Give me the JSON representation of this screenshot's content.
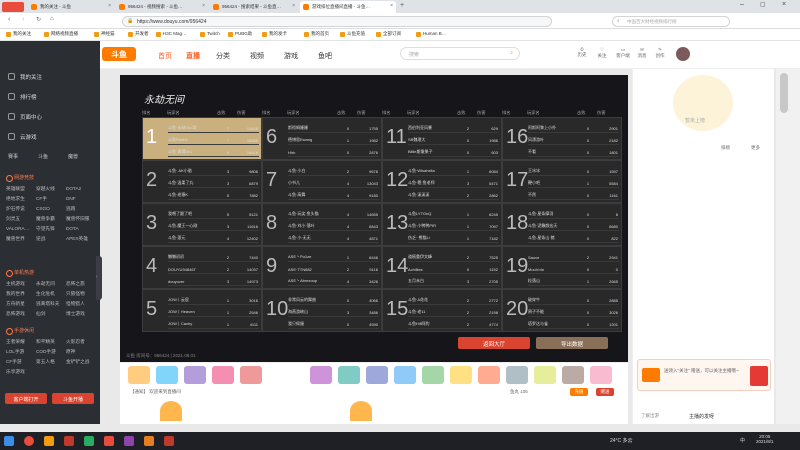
{
  "browser": {
    "tabs": [
      {
        "label": "我的关注 - 斗鱼",
        "active": false
      },
      {
        "label": "956424 - 视频搜索 - 斗鱼…",
        "active": false
      },
      {
        "label": "956424 - 搜索结果 - 斗鱼直…",
        "active": false
      },
      {
        "label": "游戏排位直播间直播 - 斗鱼…",
        "active": true
      }
    ],
    "url": "https://www.douyu.com/956424",
    "search_placeholder": "中国百大财经视频排行榜",
    "bookmarks": [
      "我的关注",
      "网络视频直播",
      "神经猫",
      "开发者",
      "H3C Mag…",
      "Twitch",
      "PUBG助",
      "我的发卡",
      "我的首页",
      "斗鱼充值",
      "全部订阅",
      "Human B…"
    ]
  },
  "header": {
    "logo": "斗鱼",
    "nav": [
      "首页",
      "直播",
      "分类",
      "视频",
      "游戏",
      "鱼吧"
    ],
    "search_placeholder": "搜索",
    "icons": [
      "历史",
      "关注",
      "客户端",
      "消息",
      "创作"
    ]
  },
  "sidebar": {
    "top": [
      {
        "label": "我的关注",
        "icon": "heart-icon"
      },
      {
        "label": "排行榜",
        "icon": "trophy-icon"
      },
      {
        "label": "页面中心",
        "icon": "grid-icon"
      },
      {
        "label": "云游戏",
        "icon": "cloud-icon"
      }
    ],
    "row_icons": [
      "赛事",
      "斗鱼",
      "魔兽"
    ],
    "sections": [
      {
        "title": "网游竞技",
        "items": [
          "英雄联盟",
          "穿越火线",
          "DOTA2",
          "绝地求生",
          "CF手",
          "DNF",
          "炉石传说",
          "CSGO",
          "逃跑",
          "剑灵五",
          "魔兽争霸",
          "魔兽怀旧服",
          "VALORA…",
          "守望先锋",
          "DOTA",
          "魔兽世界",
          "逆战",
          "APEX英雄"
        ]
      },
      {
        "title": "单机热游",
        "items": [
          "主机游戏",
          "永劫无间",
          "恐怖之旅",
          "我的世界",
          "生化危机",
          "只狼怪物",
          "方舟新星",
          "逃离塔科夫",
          "怪物猎人",
          "恐怖游戏",
          "仙剑",
          "博士游戏"
        ]
      },
      {
        "title": "手游休闲",
        "items": [
          "王者荣耀",
          "和平精英",
          "火影忍者",
          "LOL手游",
          "COD手游",
          "原神",
          "CF手游",
          "第五人格",
          "金铲铲之战",
          "乐享游戏"
        ]
      }
    ],
    "buttons": [
      "客户端打开",
      "斗鱼开播"
    ]
  },
  "player": {
    "calligraphy": "永劫无间",
    "columns": [
      "排名",
      "玩家名",
      "击败",
      "伤害"
    ],
    "groups": [
      {
        "rank": "1",
        "players": [
          [
            "斗鱼·永劫Gk4哥",
            "7",
            "14408"
          ],
          [
            "斗鱼Rebbit",
            "7",
            "15586"
          ],
          [
            "斗鱼·素得Ex1",
            "4",
            "16618"
          ]
        ]
      },
      {
        "rank": "2",
        "players": [
          [
            "斗鱼·.AK小骆",
            "3",
            "9806"
          ],
          [
            "斗鱼·温柔了丸",
            "3",
            "6879"
          ],
          [
            "斗鱼·老猿K",
            "5",
            "7882"
          ]
        ]
      },
      {
        "rank": "3",
        "players": [
          [
            "我喂了跟了吧",
            "5",
            "5121"
          ],
          [
            "斗鱼-魔王一心刚",
            "3",
            "11616"
          ],
          [
            "斗鱼·菠元",
            "4",
            "12402"
          ]
        ]
      },
      {
        "rank": "4",
        "players": [
          [
            "懒懒初初",
            "2",
            "7440"
          ],
          [
            "DOUYU94846T",
            "2",
            "14037"
          ],
          [
            "douyuver",
            "3",
            "14973"
          ]
        ]
      },
      {
        "rank": "5",
        "players": [
          [
            "JOW丨云屁",
            "1",
            "3016"
          ],
          [
            "JOW丨Heaven",
            "1",
            "2546"
          ],
          [
            "JOW丨Cachy",
            "1",
            "4111"
          ]
        ]
      },
      {
        "rank": "6",
        "players": [
          [
            "斯彻姆姗姗",
            "0",
            "1755"
          ],
          [
            "德博思Ewang",
            "1",
            "1982"
          ],
          [
            "Hhh",
            "0",
            "2876"
          ]
        ]
      },
      {
        "rank": "7",
        "players": [
          [
            "斗鱼·小白",
            "2",
            "9678"
          ],
          [
            "小书儿",
            "4",
            "13043"
          ],
          [
            "斗鱼·高舞",
            "4",
            "9180"
          ]
        ]
      },
      {
        "rank": "8",
        "players": [
          [
            "斗鱼·玩笑·鱼头猫",
            "4",
            "14655"
          ],
          [
            "斗鱼·刘小·落叶",
            "4",
            "6843"
          ],
          [
            "斗鱼·小·无无",
            "4",
            "4871"
          ]
        ]
      },
      {
        "rank": "9",
        "players": [
          [
            "ASE丶Pu1ze",
            "1",
            "6446"
          ],
          [
            "ASE·TTN682",
            "2",
            "5116"
          ],
          [
            "ASE丶Abrezoup",
            "4",
            "3426"
          ]
        ]
      },
      {
        "rank": "10",
        "players": [
          [
            "非常风云的舞曲",
            "0",
            "4066"
          ],
          [
            "海燕游峡山",
            "3",
            "3486"
          ],
          [
            "我只佩服",
            "0",
            "4590"
          ]
        ]
      },
      {
        "rank": "11",
        "players": [
          [
            "西伯利亚风暴",
            "2",
            "629"
          ],
          [
            "SB魏理大",
            "0",
            "1986"
          ],
          [
            "Billie斯嫩果子",
            "0",
            "603"
          ]
        ]
      },
      {
        "rank": "12",
        "players": [
          [
            "斗鱼·Wlsaheila",
            "1",
            "6084"
          ],
          [
            "斗鱼·羲·鱼老师",
            "3",
            "5471"
          ],
          [
            "斗鱼·溪溪溪",
            "2",
            "2862"
          ]
        ]
      },
      {
        "rank": "13",
        "players": [
          [
            "斗鱼LYTOnQ",
            "1",
            "6245"
          ],
          [
            "斗鱼·小鸭鸭PIR",
            "1",
            "7097"
          ],
          [
            "伤乏··熊猫Li",
            "1",
            "7182"
          ]
        ]
      },
      {
        "rank": "14",
        "players": [
          [
            "道痕重伊文峰",
            "2",
            "7525"
          ],
          [
            "Achillies",
            "0",
            "1152"
          ],
          [
            "五月未白",
            "3",
            "2705"
          ]
        ]
      },
      {
        "rank": "15",
        "players": [
          [
            "斗鱼·A花花",
            "2",
            "2772"
          ],
          [
            "斗鱼·老11",
            "2",
            "2198"
          ],
          [
            "斗鱼Hill阿豹",
            "2",
            "4774"
          ]
        ]
      },
      {
        "rank": "16",
        "players": [
          [
            "阿斯阿黎上小扑",
            "0",
            "2901"
          ],
          [
            "风漂游叶",
            "0",
            "2182"
          ],
          [
            "不看",
            "0",
            "1801"
          ]
        ]
      },
      {
        "rank": "17",
        "players": [
          [
            "王冰冰",
            "0",
            "1597"
          ],
          [
            "鞭小吧",
            "1",
            "5584"
          ],
          [
            "不然",
            "0",
            "1161"
          ]
        ]
      },
      {
        "rank": "18",
        "players": [
          [
            "斗鱼·星条摩羽",
            "0",
            "8"
          ],
          [
            "斗鱼·泥鳅颜宏天",
            "0",
            "6680"
          ],
          [
            "斗鱼-星条山·猪",
            "0",
            "822"
          ]
        ]
      },
      {
        "rank": "19",
        "players": [
          [
            "Sauve",
            "2",
            "2941"
          ],
          [
            "MouVnIn",
            "0",
            "0"
          ],
          [
            "粒落山",
            "1",
            "2665"
          ]
        ]
      },
      {
        "rank": "20",
        "players": [
          [
            "破穿牛",
            "0",
            "2885"
          ],
          [
            "鸦子不能",
            "0",
            "3026"
          ],
          [
            "塔罗达与雀",
            "0",
            "1201"
          ]
        ]
      }
    ],
    "btn_back": "返回大厅",
    "btn_export": "导出数据",
    "room_info": "斗鱼 房间号：956424 | 2021.08.01"
  },
  "gifts": {
    "labels": [
      "赠送大厅",
      "鲨鱼",
      "PK玩法",
      "赠送",
      "专属",
      "活动",
      "小铃铛",
      "鱼丸",
      "大星",
      "福袋",
      "宝箱"
    ],
    "status_left": "【通知】 欢迎来到直播间",
    "level": "鱼丸 105",
    "btn_recharge": "充值",
    "btn_charge": "赠送"
  },
  "rightpanel": {
    "mascot_text": "暂未上榜",
    "btn_rank": "排榜",
    "btn_more": "更多",
    "notice": "送领入\"关注\" 赠送，可以关注主播哦~",
    "tab1": "了解出游",
    "tab2": "主播的发呀"
  },
  "taskbar": {
    "weather": "24°C 多云",
    "time": "20:05",
    "date": "2021/8/1",
    "lang": "中"
  }
}
